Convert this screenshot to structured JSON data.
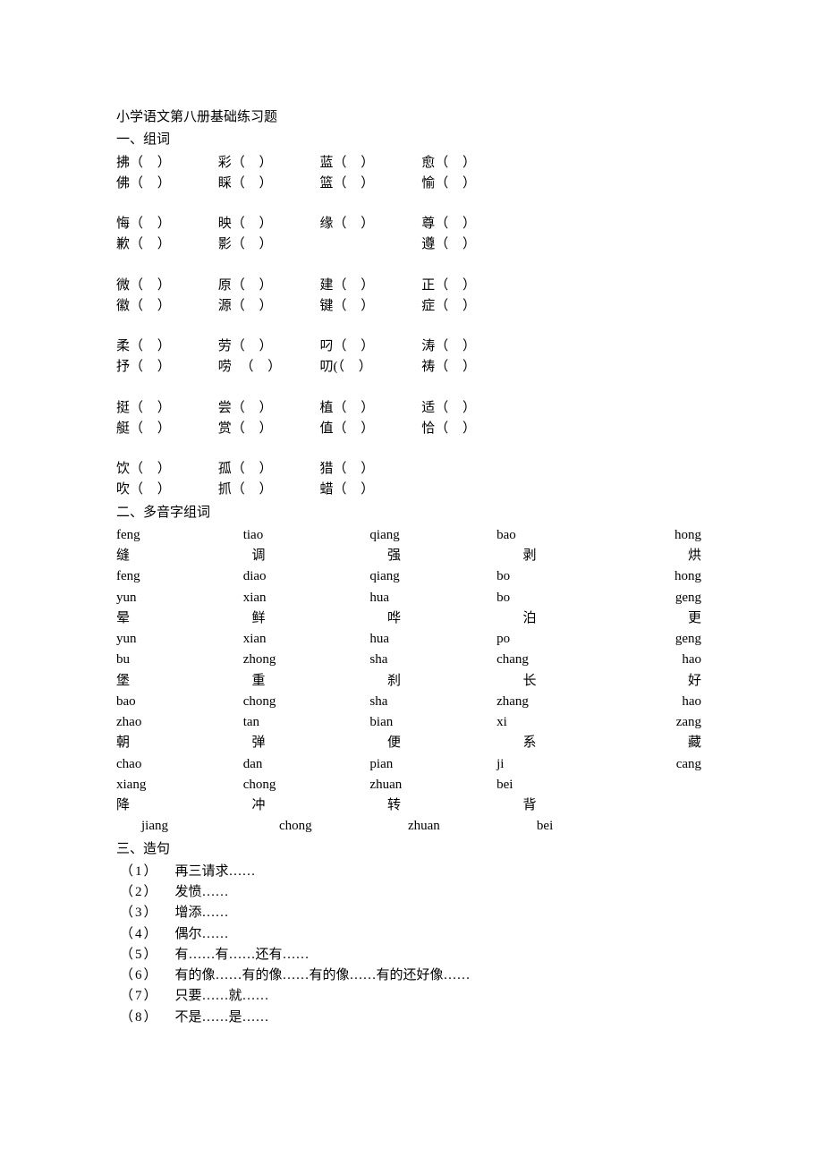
{
  "title": "小学语文第八册基础练习题",
  "sections": {
    "s1": {
      "heading": "一、组词"
    },
    "s2": {
      "heading": "二、多音字组词"
    },
    "s3": {
      "heading": "三、造句"
    }
  },
  "group1": {
    "g0": {
      "a": "拂",
      "b": "彩",
      "c": "蓝",
      "d": "愈"
    },
    "g1": {
      "a": "佛",
      "b": "睬",
      "c": "篮",
      "d": "愉"
    },
    "g2": {
      "a": "悔",
      "b": "映",
      "c": "缘",
      "d": "尊"
    },
    "g3": {
      "a": "歉",
      "b": "影",
      "c": "",
      "d": "遵"
    },
    "g4": {
      "a": "微",
      "b": "原",
      "c": "建",
      "d": "正"
    },
    "g5": {
      "a": "徽",
      "b": "源",
      "c": "键",
      "d": "症"
    },
    "g6": {
      "a": "柔",
      "b": "劳",
      "c": "叼",
      "d": "涛"
    },
    "g7": {
      "a": "抒",
      "b": "唠",
      "c": "叨(",
      "d": "祷"
    },
    "g8": {
      "a": "挺",
      "b": "尝",
      "c": "植",
      "d": "适"
    },
    "g9": {
      "a": "艇",
      "b": "赏",
      "c": "值",
      "d": "恰"
    },
    "g10": {
      "a": "饮",
      "b": "孤",
      "c": "猎",
      "d": ""
    },
    "g11": {
      "a": "吹",
      "b": "抓",
      "c": "蜡",
      "d": ""
    }
  },
  "paren_open": "（",
  "paren_close": "）",
  "poly": {
    "r0": {
      "c1": "feng",
      "c2": "tiao",
      "c3": "qiang",
      "c4": "bao",
      "c5": "hong"
    },
    "r1": {
      "c1": "缝",
      "c2": "调",
      "c3": "强",
      "c4": "剥",
      "c5": "烘"
    },
    "r2": {
      "c1": "feng",
      "c2": "diao",
      "c3": "qiang",
      "c4": "bo",
      "c5": "hong"
    },
    "r3": {
      "c1": "yun",
      "c2": "xian",
      "c3": "hua",
      "c4": "bo",
      "c5": "geng"
    },
    "r4": {
      "c1": "晕",
      "c2": "鲜",
      "c3": "哗",
      "c4": "泊",
      "c5": "更"
    },
    "r5": {
      "c1": "yun",
      "c2": "xian",
      "c3": "hua",
      "c4": "po",
      "c5": "geng"
    },
    "r6": {
      "c1": "bu",
      "c2": "zhong",
      "c3": "sha",
      "c4": "chang",
      "c5": "hao"
    },
    "r7": {
      "c1": "堡",
      "c2": "重",
      "c3": "刹",
      "c4": "长",
      "c5": "好"
    },
    "r8": {
      "c1": "bao",
      "c2": "chong",
      "c3": "sha",
      "c4": "zhang",
      "c5": "hao"
    },
    "r9": {
      "c1": "zhao",
      "c2": "tan",
      "c3": "bian",
      "c4": "xi",
      "c5": "zang"
    },
    "r10": {
      "c1": "朝",
      "c2": "弹",
      "c3": "便",
      "c4": "系",
      "c5": "藏"
    },
    "r11": {
      "c1": "chao",
      "c2": "dan",
      "c3": "pian",
      "c4": "ji",
      "c5": "cang"
    },
    "r12": {
      "c1": "xiang",
      "c2": "chong",
      "c3": "zhuan",
      "c4": "bei",
      "c5": ""
    },
    "r13": {
      "c1": "降",
      "c2": "冲",
      "c3": "转",
      "c4": "背",
      "c5": ""
    },
    "r14": {
      "c1": "jiang",
      "c2": "chong",
      "c3": "zhuan",
      "c4": "bei",
      "c5": ""
    }
  },
  "sentences": {
    "i1": {
      "n": "（1）",
      "t": "再三请求……"
    },
    "i2": {
      "n": "（2）",
      "t": "发愤……"
    },
    "i3": {
      "n": "（3）",
      "t": "增添……"
    },
    "i4": {
      "n": "（4）",
      "t": "偶尔……"
    },
    "i5": {
      "n": "（5）",
      "t": "有……有……还有……"
    },
    "i6": {
      "n": "（6）",
      "t": "有的像……有的像……有的像……有的还好像……"
    },
    "i7": {
      "n": "（7）",
      "t": "只要……就……"
    },
    "i8": {
      "n": "（8）",
      "t": "不是……是……"
    }
  }
}
